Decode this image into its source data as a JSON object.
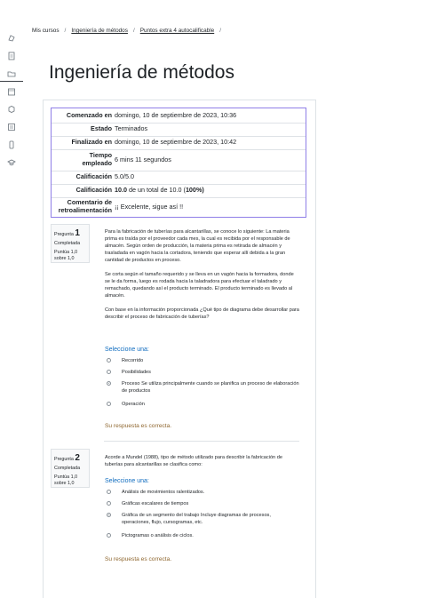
{
  "breadcrumb": {
    "items": [
      "Mis cursos",
      "Ingeniería de métodos",
      "Puntos extra 4 autocalificable"
    ],
    "separator": "/"
  },
  "page": {
    "title": "Ingeniería de métodos"
  },
  "summary": {
    "rows": [
      {
        "label": "Comenzado en",
        "value": "domingo, 10 de septiembre de 2023, 10:36"
      },
      {
        "label": "Estado",
        "value": "Terminados"
      },
      {
        "label": "Finalizado en",
        "value": "domingo, 10 de septiembre de 2023, 10:42"
      },
      {
        "label": "Tiempo empleado",
        "value": "6 mins 11 segundos"
      },
      {
        "label": "Calificación",
        "value": "5.0/5.0"
      },
      {
        "label": "Calificación",
        "value_bold": "10.0",
        "value_rest": " de un total de 10.0 (",
        "value_bold2": "100",
        "value_end": "%)"
      },
      {
        "label": "Comentario de retroalimentación",
        "value": "¡¡ Excelente, sigue así !!"
      }
    ]
  },
  "questions": [
    {
      "prefix": "Pregunta",
      "number": "1",
      "status": "Completada",
      "score": "Puntúa 1,0 sobre 1,0",
      "paragraphs": [
        "Para la fabricación de tuberías para alcantarillas, se conoce lo siguiente: La materia prima es traída por el proveedor cada mes, la cual es recibida por el responsable de almacén. Según orden de producción, la materia prima es retirada de almacén y trasladada en vagón hacia la cortadora, teniendo que esperar allí debida a la gran cantidad de productos en proceso.",
        "Se corta según el tamaño requerido y se lleva en un vagón hacia la formadora, donde se le da forma, luego es rodada hacia la taladradora para efectuar el taladrado y remachado, quedando así el producto terminado. El producto terminado es llevado al almacén.",
        "Con base en la información proporcionada ¿Qué tipo de diagrama debe desarrollar para describir el proceso de fabricación de tuberías?"
      ],
      "select_label": "Seleccione una:",
      "options": [
        {
          "text": "Recorrido",
          "selected": false
        },
        {
          "text": "Posibilidades",
          "selected": false
        },
        {
          "text": "Proceso    Se utiliza principalmente cuando se planifica un proceso de elaboración de productos",
          "selected": true
        },
        {
          "text": "Operación",
          "selected": false
        }
      ],
      "feedback": "Su respuesta es correcta."
    },
    {
      "prefix": "Pregunta",
      "number": "2",
      "status": "Completada",
      "score": "Puntúa 1,0 sobre 1,0",
      "paragraphs": [
        "Acorde a Mundel (1988), tipo de método utilizado para describir la fabricación de tuberías para alcantarillas se clasifica como:"
      ],
      "select_label": "Seleccione una:",
      "options": [
        {
          "text": "Análisis de movimientos ralentizados.",
          "selected": false
        },
        {
          "text": "Gráficas escalares de tiempos",
          "selected": false
        },
        {
          "text": "Gráfica de un segmento del trabajo    Incluye diagramas de procesos, operaciones, flujo, cursogramas, etc.",
          "selected": true
        },
        {
          "text": "Pictogramas o análisis de ciclos.",
          "selected": false
        }
      ],
      "feedback": "Su respuesta es correcta."
    }
  ],
  "colors": {
    "accent": "#0f6cbf",
    "summary_border": "#8f7ee7",
    "feedback": "#8e662e"
  },
  "sidebar_icons": [
    "hat-icon",
    "file-icon",
    "folder-icon",
    "calendar-icon",
    "box-icon",
    "document-icon",
    "phone-icon",
    "graduation-cap-icon"
  ]
}
